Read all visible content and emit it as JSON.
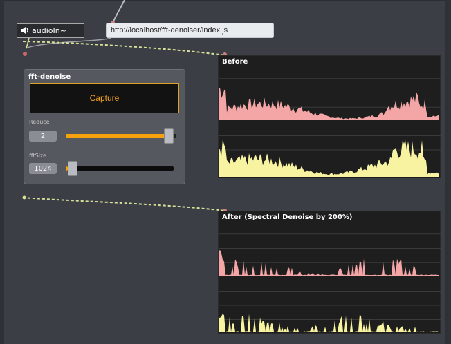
{
  "audio_node": {
    "label": "audioIn~",
    "icon": "speaker-icon"
  },
  "url_node": {
    "text": "http://localhost/fft-denoiser/index.js"
  },
  "panel": {
    "title": "fft-denoise",
    "capture_label": "Capture",
    "reduce": {
      "label": "Reduce",
      "value": "2",
      "level": 0.97
    },
    "fftsize": {
      "label": "fftSize",
      "value": "1024",
      "level": 0.02
    }
  },
  "scopes": {
    "before": {
      "title": "Before"
    },
    "after": {
      "title": "After (Spectral Denoise by 200%)"
    }
  },
  "colors": {
    "accent": "#f5a20d",
    "spectrum_red": "#f4a6a6",
    "spectrum_yellow": "#f7f3a0",
    "wire": "#d8e39a"
  }
}
